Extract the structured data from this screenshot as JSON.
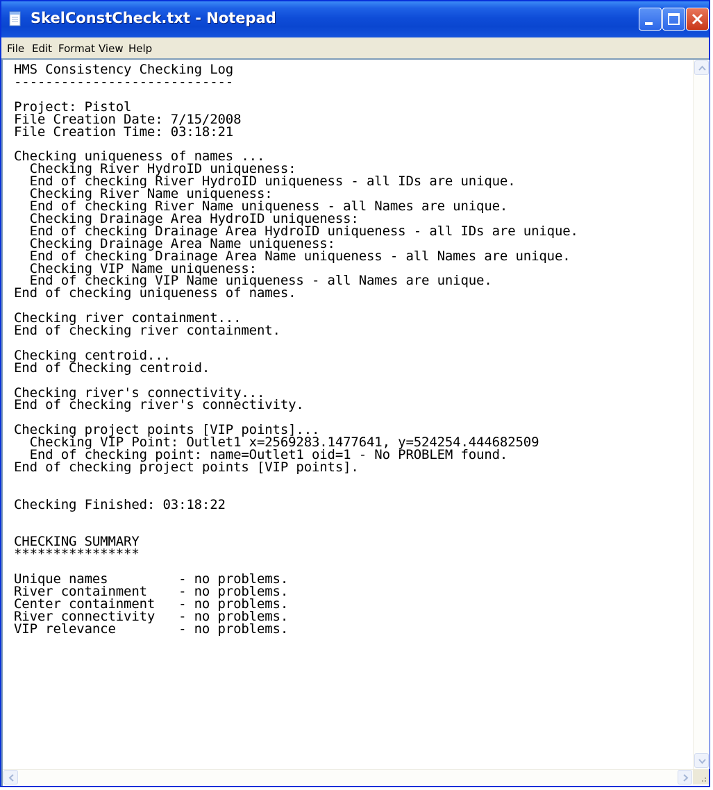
{
  "window": {
    "title": "SkelConstCheck.txt - Notepad",
    "icon": "notepad-icon",
    "controls": [
      "minimize-icon",
      "maximize-icon",
      "close-icon"
    ]
  },
  "menu": {
    "items": [
      "File",
      "Edit",
      "Format",
      "View",
      "Help"
    ]
  },
  "document": {
    "content": "HMS Consistency Checking Log\n----------------------------\n\nProject: Pistol\nFile Creation Date: 7/15/2008\nFile Creation Time: 03:18:21\n\nChecking uniqueness of names ...\n  Checking River HydroID uniqueness:\n  End of checking River HydroID uniqueness - all IDs are unique.\n  Checking River Name uniqueness:\n  End of checking River Name uniqueness - all Names are unique.\n  Checking Drainage Area HydroID uniqueness:\n  End of checking Drainage Area HydroID uniqueness - all IDs are unique.\n  Checking Drainage Area Name uniqueness:\n  End of checking Drainage Area Name uniqueness - all Names are unique.\n  Checking VIP Name uniqueness:\n  End of checking VIP Name uniqueness - all Names are unique.\nEnd of checking uniqueness of names.\n\nChecking river containment...\nEnd of checking river containment.\n\nChecking centroid...\nEnd of Checking centroid.\n\nChecking river's connectivity...\nEnd of checking river's connectivity.\n\nChecking project points [VIP points]...\n  Checking VIP Point: Outlet1 x=2569283.1477641, y=524254.444682509\n  End of checking point: name=Outlet1 oid=1 - No PROBLEM found.\nEnd of checking project points [VIP points].\n\n\nChecking Finished: 03:18:22\n\n\nCHECKING SUMMARY\n****************\n\nUnique names         - no problems.\nRiver containment    - no problems.\nCenter containment   - no problems.\nRiver connectivity   - no problems.\nVIP relevance        - no problems."
  },
  "colors": {
    "titlebar": "#0a46d0",
    "menubar": "#ece9d8",
    "close_button": "#c8381a",
    "editor_background": "#ffffff"
  }
}
